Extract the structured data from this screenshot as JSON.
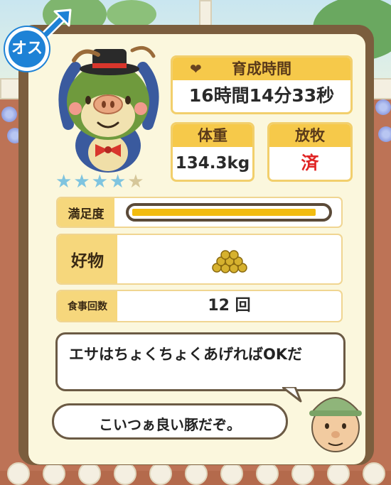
{
  "profile": {
    "gender_label": "オス",
    "rating_filled": 4,
    "rating_total": 5
  },
  "stats": {
    "raise_time_label": "育成時間",
    "raise_time_value": "16時間14分33秒",
    "weight_label": "体重",
    "weight_value": "134.3kg",
    "grazing_label": "放牧",
    "grazing_value": "済"
  },
  "details": {
    "satisfaction_label": "満足度",
    "satisfaction_level": 0.95,
    "favorite_food_label": "好物",
    "meal_count_label": "食事回数",
    "meal_count_value": "12 回"
  },
  "dialogue": {
    "tip_text": "エサはちょくちょくあげればOKだ",
    "comment_text": "こいつぁ良い豚だぞ。"
  },
  "colors": {
    "accent_yellow": "#f6c94a",
    "grazing_red": "#e02424",
    "star_filled": "#7fc4df",
    "star_empty": "#d6c79a",
    "male_blue": "#1e82d6"
  },
  "icons": {
    "gender": "male-symbol-icon",
    "heart": "heart-icon",
    "food": "grain-pile-icon"
  }
}
